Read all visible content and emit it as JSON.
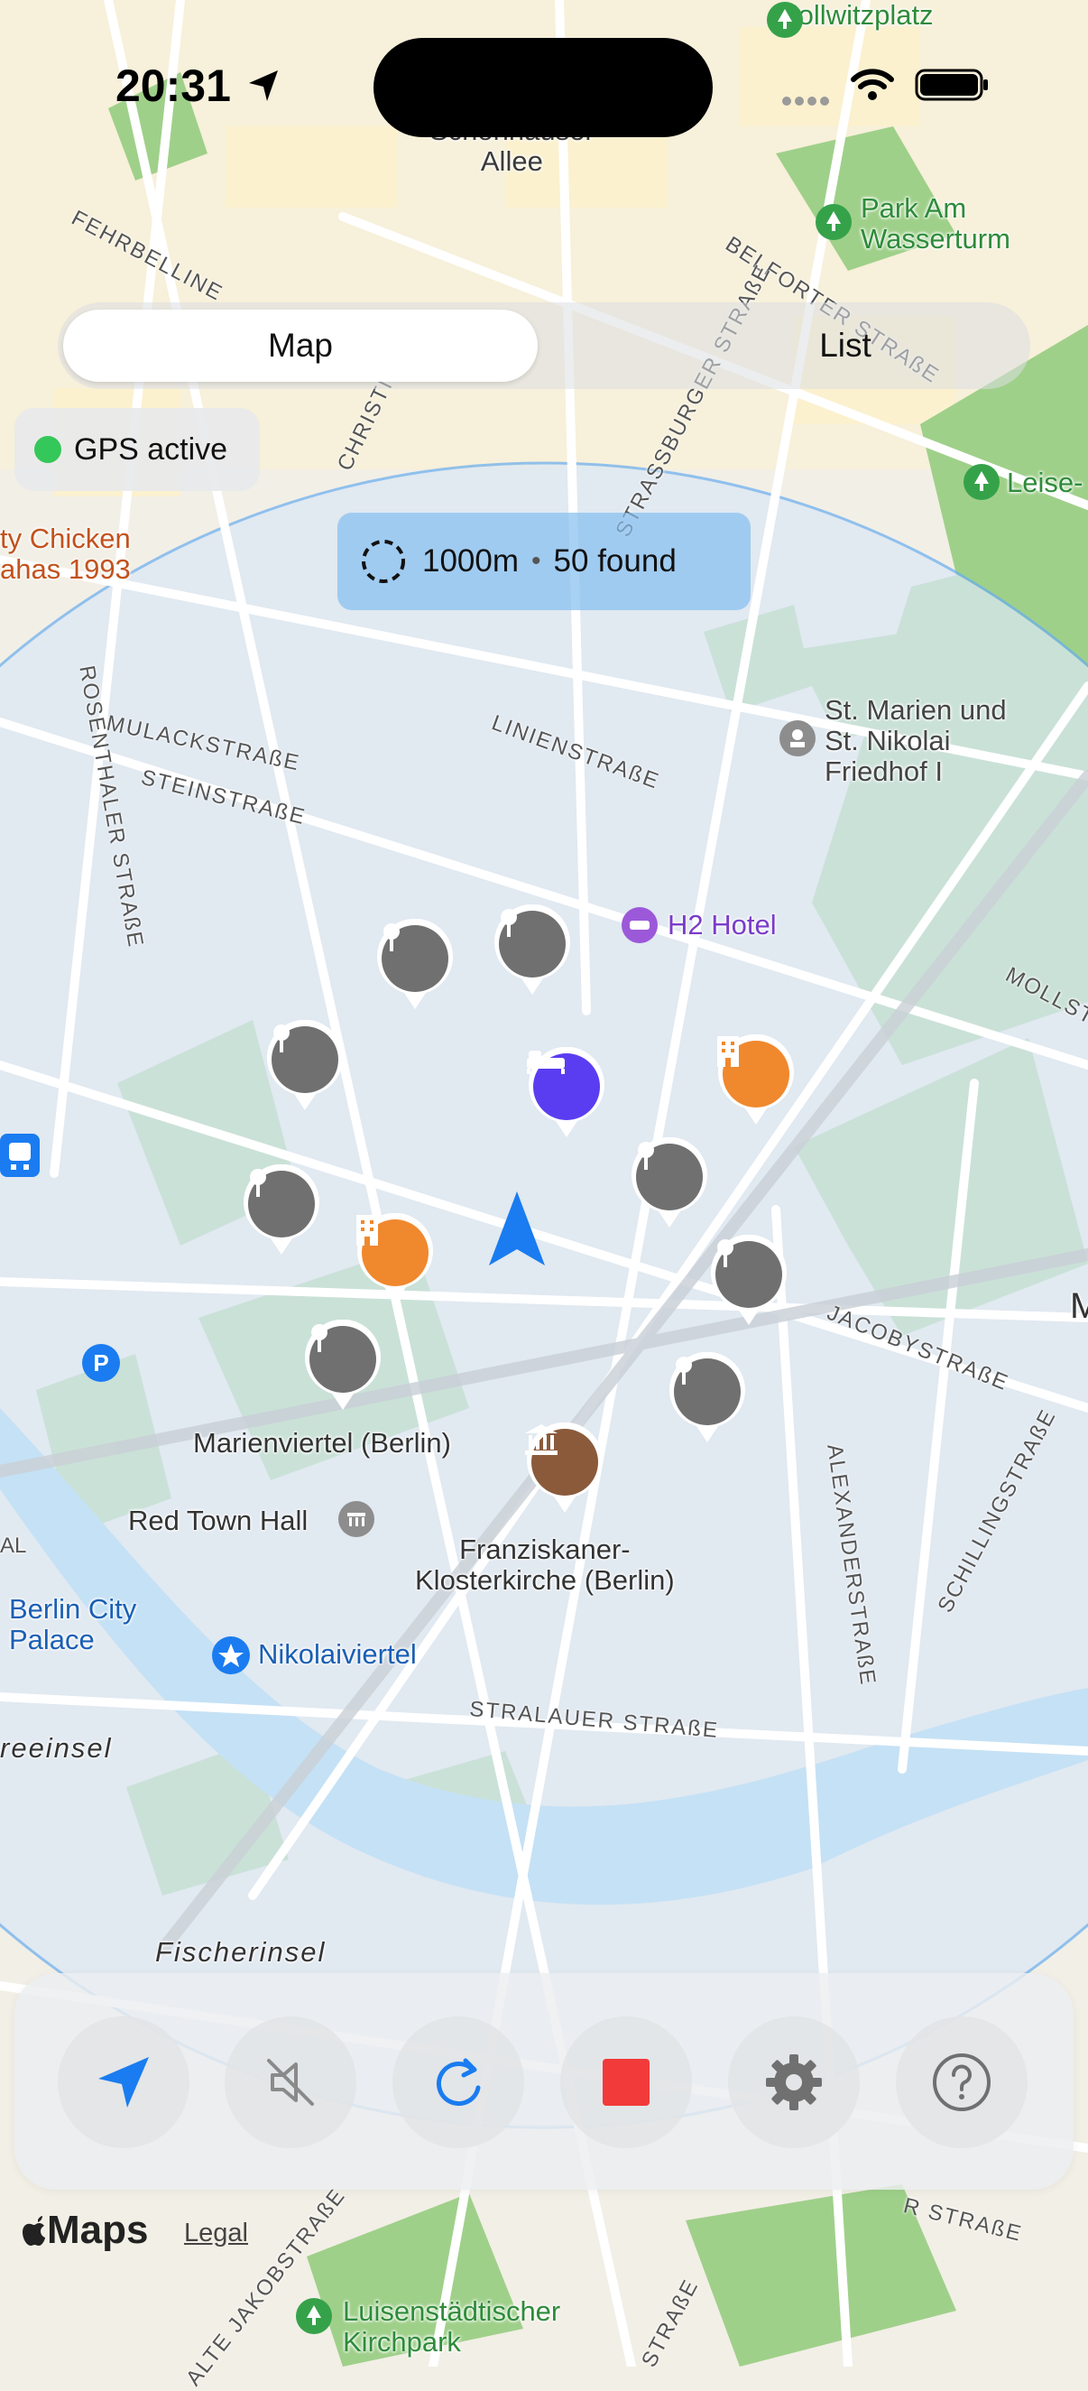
{
  "status_bar": {
    "time": "20:31"
  },
  "view_toggle": {
    "map_label": "Map",
    "list_label": "List",
    "selected": "Map"
  },
  "gps": {
    "label": "GPS active",
    "color": "#34c759"
  },
  "search": {
    "radius": "1000m",
    "found": "50 found"
  },
  "map": {
    "places": [
      {
        "id": "kollwitzplatz",
        "label": "Kollwitzplatz"
      },
      {
        "id": "schonhauser",
        "label": "Schönhauser\nAllee"
      },
      {
        "id": "park-am-wasserturm",
        "label": "Park Am\nWasserturm"
      },
      {
        "id": "leise",
        "label": "Leise-"
      },
      {
        "id": "chicken",
        "label": "ty Chicken\nahas 1993"
      },
      {
        "id": "st-marien",
        "label": "St. Marien und\nSt. Nikolai\nFriedhof I"
      },
      {
        "id": "h2-hotel",
        "label": "H2 Hotel"
      },
      {
        "id": "marienviertel",
        "label": "Marienviertel (Berlin)"
      },
      {
        "id": "red-town-hall",
        "label": "Red Town Hall"
      },
      {
        "id": "franziskaner",
        "label": "Franziskaner-\nKlosterkirche (Berlin)"
      },
      {
        "id": "berlin-city-palace",
        "label": "Berlin City\nPalace"
      },
      {
        "id": "nikolaiviertel",
        "label": "Nikolaiviertel"
      },
      {
        "id": "reeinsel",
        "label": "reeinsel"
      },
      {
        "id": "fischerinsel",
        "label": "Fischerinsel"
      },
      {
        "id": "luisenstadtischer",
        "label": "Luisenstädtischer\nKirchpark"
      },
      {
        "id": "al",
        "label": "AL"
      },
      {
        "id": "m",
        "label": "M"
      }
    ],
    "streets": [
      {
        "id": "fehrbelliner",
        "label": "FEHRBELLINE"
      },
      {
        "id": "belforter",
        "label": "BELFORTER STRAßE"
      },
      {
        "id": "christine",
        "label": "CHRISTINE"
      },
      {
        "id": "strassburger",
        "label": "STRASSBURGER STRAßE"
      },
      {
        "id": "mulackstrasse",
        "label": "MULACKSTRAßE"
      },
      {
        "id": "steinstrasse",
        "label": "STEINSTRAßE"
      },
      {
        "id": "rosenthaler",
        "label": "ROSENTHALER STRAßE"
      },
      {
        "id": "linienstrasse",
        "label": "LINIENSTRAßE"
      },
      {
        "id": "mollst",
        "label": "MOLLST"
      },
      {
        "id": "jacobystrasse",
        "label": "JACOBYSTRAßE"
      },
      {
        "id": "alexanderstrasse",
        "label": "ALEXANDERSTRAßE"
      },
      {
        "id": "schillingstrasse",
        "label": "SCHILLINGSTRAßE"
      },
      {
        "id": "stralauer",
        "label": "STRALAUER STRAßE"
      },
      {
        "id": "alte-jakob",
        "label": "ALTE JAKOBSTRAßE"
      },
      {
        "id": "r-strasse",
        "label": "R STRAßE"
      },
      {
        "id": "strasse-bottom",
        "label": "STRAßE"
      }
    ]
  },
  "toolbar": {
    "buttons": [
      {
        "id": "locate",
        "icon": "location-arrow-icon",
        "color": "#1a7cf0"
      },
      {
        "id": "mute",
        "icon": "speaker-muted-icon",
        "color": "#8a8a8a"
      },
      {
        "id": "refresh",
        "icon": "refresh-icon",
        "color": "#1a7cf0"
      },
      {
        "id": "stop",
        "icon": "stop-icon",
        "color": "#f23a3a"
      },
      {
        "id": "settings",
        "icon": "gear-icon",
        "color": "#707070"
      },
      {
        "id": "help",
        "icon": "question-icon",
        "color": "#707070"
      }
    ]
  },
  "footer": {
    "maps_brand": "Maps",
    "legal": "Legal"
  },
  "colors": {
    "pin_gray": "#707070",
    "pin_orange": "#f0882d",
    "pin_purple": "#5a3df0",
    "pin_brown": "#8a5a3b",
    "accent_blue": "#1a7cf0"
  }
}
